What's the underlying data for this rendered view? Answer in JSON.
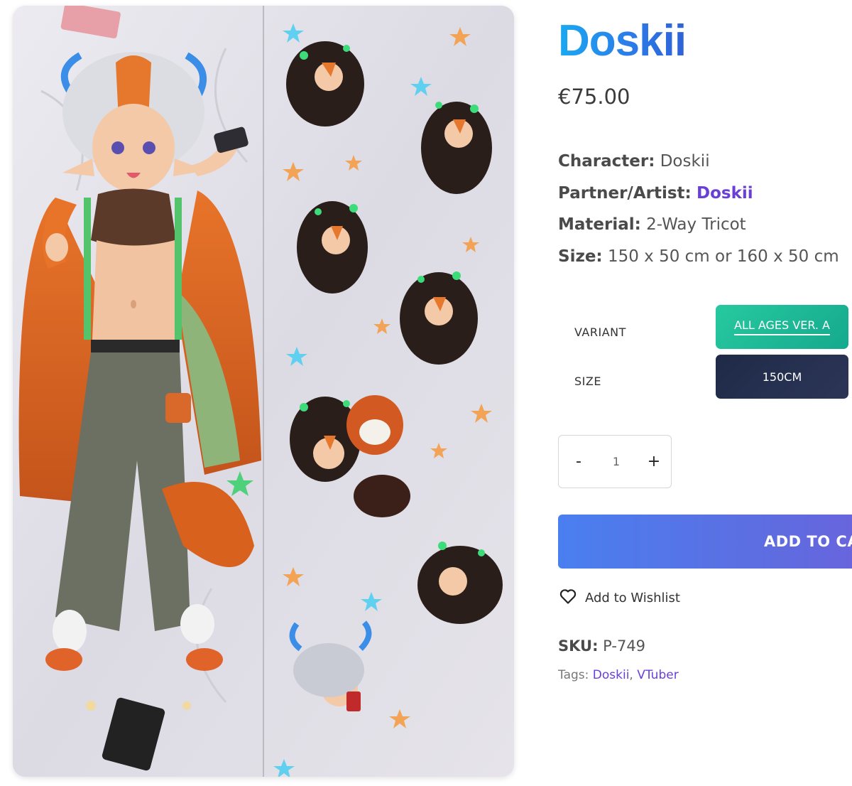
{
  "product": {
    "title": "Doskii",
    "price": "€75.00"
  },
  "specs": {
    "character_label": "Character:",
    "character_value": "Doskii",
    "partner_label": "Partner/Artist:",
    "partner_value": "Doskii",
    "material_label": "Material:",
    "material_value": "2-Way Tricot",
    "size_label": "Size:",
    "size_value": "150 x 50 cm or 160 x 50 cm"
  },
  "options": {
    "variant_label": "VARIANT",
    "variant_selected": "ALL AGES VER. A",
    "size_label": "SIZE",
    "size_selected": "150CM"
  },
  "quantity": {
    "minus": "-",
    "value": "1",
    "plus": "+"
  },
  "actions": {
    "add_to_cart": "ADD TO CA",
    "wishlist": "Add to Wishlist"
  },
  "meta": {
    "sku_label": "SKU:",
    "sku_value": "P-749",
    "tags_label": "Tags:",
    "tag_1": "Doskii",
    "tag_separator": ",",
    "tag_2": "VTuber"
  },
  "colors": {
    "title_gradient_start": "#1aa9f2",
    "title_gradient_end": "#2f62d6",
    "link_purple": "#6a3fd6",
    "variant_button": "#1fb896",
    "size_button": "#242e4d",
    "cart_button": "#5575e8"
  },
  "icons": {
    "wishlist": "heart-outline-icon"
  }
}
